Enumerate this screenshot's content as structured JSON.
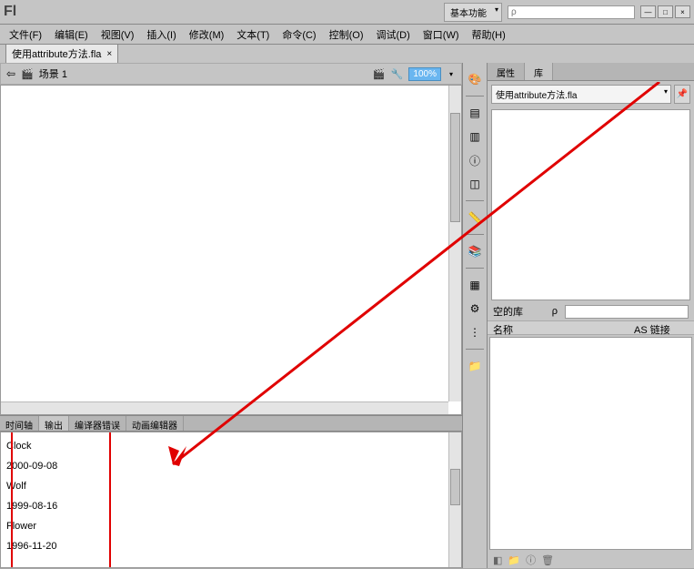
{
  "header": {
    "logo": "Fl",
    "workspace": "基本功能",
    "search_placeholder": "ρ"
  },
  "menu": {
    "file": "文件(F)",
    "edit": "编辑(E)",
    "view": "视图(V)",
    "insert": "插入(I)",
    "modify": "修改(M)",
    "text": "文本(T)",
    "command": "命令(C)",
    "control": "控制(O)",
    "debug": "调试(D)",
    "window": "窗口(W)",
    "help": "帮助(H)"
  },
  "file_tab": {
    "name": "使用attribute方法.fla",
    "close": "×"
  },
  "stage": {
    "scene": "场景 1",
    "zoom": "100%"
  },
  "bottom_tabs": {
    "timeline": "时间轴",
    "output": "输出",
    "compiler": "编译器错误",
    "motion": "动画编辑器"
  },
  "output": {
    "l1": "Clock",
    "l2": "2000-09-08",
    "l3": "Wolf",
    "l4": "1999-08-16",
    "l5": "Flower",
    "l6": "1996-11-20"
  },
  "right_panel": {
    "tab_props": "属性",
    "tab_lib": "库",
    "lib_file": "使用attribute方法.fla",
    "empty_lib": "空的库",
    "col_name": "名称",
    "col_link": "AS 链接"
  }
}
